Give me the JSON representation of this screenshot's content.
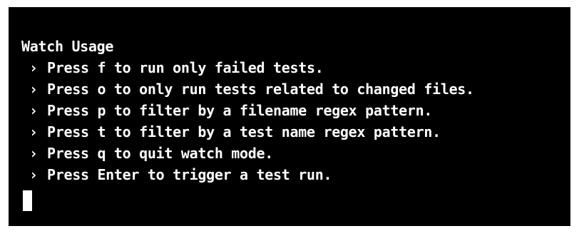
{
  "terminal": {
    "heading": "Watch Usage",
    "prompt_symbol": "›",
    "options": [
      {
        "text": "Press f to run only failed tests."
      },
      {
        "text": "Press o to only run tests related to changed files."
      },
      {
        "text": "Press p to filter by a filename regex pattern."
      },
      {
        "text": "Press t to filter by a test name regex pattern."
      },
      {
        "text": "Press q to quit watch mode."
      },
      {
        "text": "Press Enter to trigger a test run."
      }
    ]
  }
}
